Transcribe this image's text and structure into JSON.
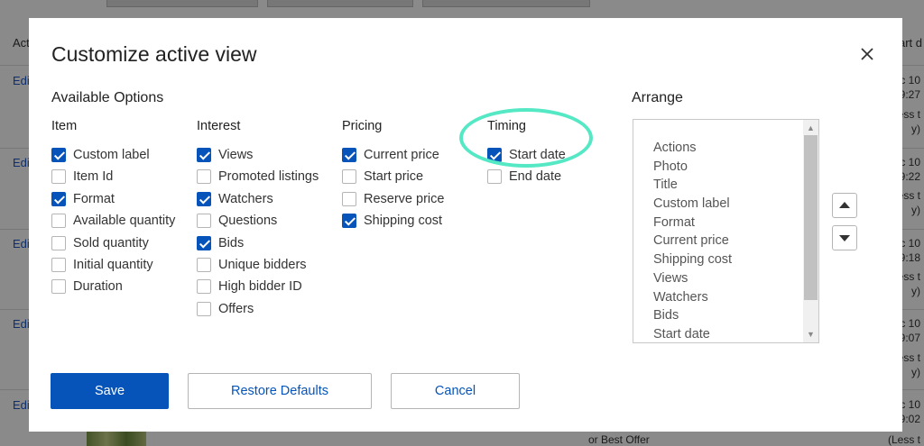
{
  "background": {
    "column_header_left": "Acti",
    "column_header_right": "art d",
    "edit_label": "Edi",
    "row_right_texts": [
      "ec 10",
      "9:27",
      "Less t",
      "y)",
      "ec 10",
      "9:22",
      "Less t",
      "y)",
      "ec 10",
      "9:18",
      "Less t",
      "y)",
      "ec 10",
      "9:07",
      "Less t",
      "y)",
      "ec 10",
      "9:02",
      "(Less t"
    ],
    "offer_text": "or Best Offer"
  },
  "modal": {
    "title": "Customize active view",
    "available_options_label": "Available Options",
    "arrange_label": "Arrange",
    "groups": [
      {
        "title": "Item",
        "options": [
          {
            "label": "Custom label",
            "checked": true
          },
          {
            "label": "Item Id",
            "checked": false
          },
          {
            "label": "Format",
            "checked": true
          },
          {
            "label": "Available quantity",
            "checked": false
          },
          {
            "label": "Sold quantity",
            "checked": false
          },
          {
            "label": "Initial quantity",
            "checked": false
          },
          {
            "label": "Duration",
            "checked": false
          }
        ]
      },
      {
        "title": "Interest",
        "options": [
          {
            "label": "Views",
            "checked": true
          },
          {
            "label": "Promoted listings",
            "checked": false
          },
          {
            "label": "Watchers",
            "checked": true
          },
          {
            "label": "Questions",
            "checked": false
          },
          {
            "label": "Bids",
            "checked": true
          },
          {
            "label": "Unique bidders",
            "checked": false
          },
          {
            "label": "High bidder ID",
            "checked": false
          },
          {
            "label": "Offers",
            "checked": false
          }
        ]
      },
      {
        "title": "Pricing",
        "options": [
          {
            "label": "Current price",
            "checked": true
          },
          {
            "label": "Start price",
            "checked": false
          },
          {
            "label": "Reserve price",
            "checked": false
          },
          {
            "label": "Shipping cost",
            "checked": true
          }
        ]
      },
      {
        "title": "Timing",
        "options": [
          {
            "label": "Start date",
            "checked": true
          },
          {
            "label": "End date",
            "checked": false
          }
        ]
      }
    ],
    "arrange_items": [
      "Actions",
      "Photo",
      "Title",
      "Custom label",
      "Format",
      "Current price",
      "Shipping cost",
      "Views",
      "Watchers",
      "Bids",
      "Start date"
    ],
    "buttons": {
      "save": "Save",
      "restore": "Restore Defaults",
      "cancel": "Cancel"
    },
    "icons": {
      "close": "close-icon",
      "move_up": "triangle-up-icon",
      "move_down": "triangle-down-icon"
    },
    "colors": {
      "primary": "#0654ba",
      "highlight": "#54e8c5"
    }
  }
}
